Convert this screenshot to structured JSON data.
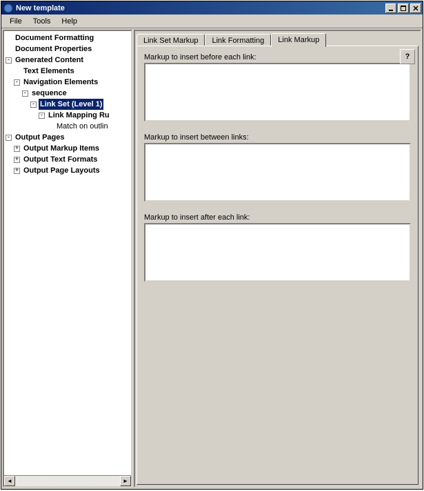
{
  "window": {
    "title": "New template"
  },
  "menu": {
    "file": "File",
    "tools": "Tools",
    "help": "Help"
  },
  "tree": {
    "doc_formatting": "Document Formatting",
    "doc_properties": "Document Properties",
    "gen_content": "Generated Content",
    "text_elements": "Text Elements",
    "nav_elements": "Navigation Elements",
    "sequence": "sequence",
    "link_set": "Link Set (Level 1)",
    "link_mapping": "Link Mapping Ru",
    "match_outline": "Match on outlin",
    "output_pages": "Output Pages",
    "output_markup_items": "Output Markup Items",
    "output_text_formats": "Output Text Formats",
    "output_page_layouts": "Output Page Layouts"
  },
  "tabs": {
    "link_set_markup": "Link Set Markup",
    "link_formatting": "Link Formatting",
    "link_markup": "Link Markup"
  },
  "form": {
    "before_label": "Markup to insert before each link:",
    "between_label": "Markup to insert between links:",
    "after_label": "Markup to insert after each link:",
    "before_value": "",
    "between_value": "",
    "after_value": "",
    "help": "?"
  },
  "toggles": {
    "minus": "-",
    "plus": "+"
  }
}
